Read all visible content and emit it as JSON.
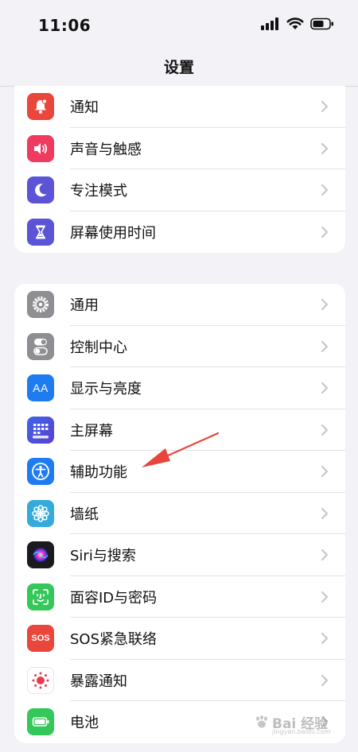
{
  "status_bar": {
    "time": "11:06",
    "icons": [
      "signal-icon",
      "wifi-icon",
      "battery-icon"
    ]
  },
  "nav": {
    "title": "设置"
  },
  "group1": {
    "items": [
      {
        "label": "通知",
        "icon": "bell-icon",
        "color": "#e9463c"
      },
      {
        "label": "声音与触感",
        "icon": "speaker-icon",
        "color": "#f03a60"
      },
      {
        "label": "专注模式",
        "icon": "moon-icon",
        "color": "#5b54d6"
      },
      {
        "label": "屏幕使用时间",
        "icon": "hourglass-icon",
        "color": "#5b54d6"
      }
    ]
  },
  "group2": {
    "items": [
      {
        "label": "通用",
        "icon": "gear-icon",
        "color": "#8e8e93"
      },
      {
        "label": "控制中心",
        "icon": "toggles-icon",
        "color": "#8e8e93"
      },
      {
        "label": "显示与亮度",
        "icon": "text-size-icon",
        "color": "#1e7cf0"
      },
      {
        "label": "主屏幕",
        "icon": "home-grid-icon",
        "color": "#3b5bd9"
      },
      {
        "label": "辅助功能",
        "icon": "accessibility-icon",
        "color": "#1e7cf0"
      },
      {
        "label": "墙纸",
        "icon": "flower-icon",
        "color": "#35aadc"
      },
      {
        "label": "Siri与搜索",
        "icon": "siri-icon",
        "color": "#222222"
      },
      {
        "label": "面容ID与密码",
        "icon": "face-id-icon",
        "color": "#34c759"
      },
      {
        "label": "SOS紧急联络",
        "icon": "sos-icon",
        "color": "#e9463c"
      },
      {
        "label": "暴露通知",
        "icon": "exposure-icon",
        "color": "#ffffff"
      },
      {
        "label": "电池",
        "icon": "battery-icon",
        "color": "#34c759"
      }
    ]
  },
  "sos_text": "SOS",
  "text_size_text": "AA",
  "watermark": {
    "text": "Bai 经验",
    "sub": "jingyan.baidu.com"
  }
}
